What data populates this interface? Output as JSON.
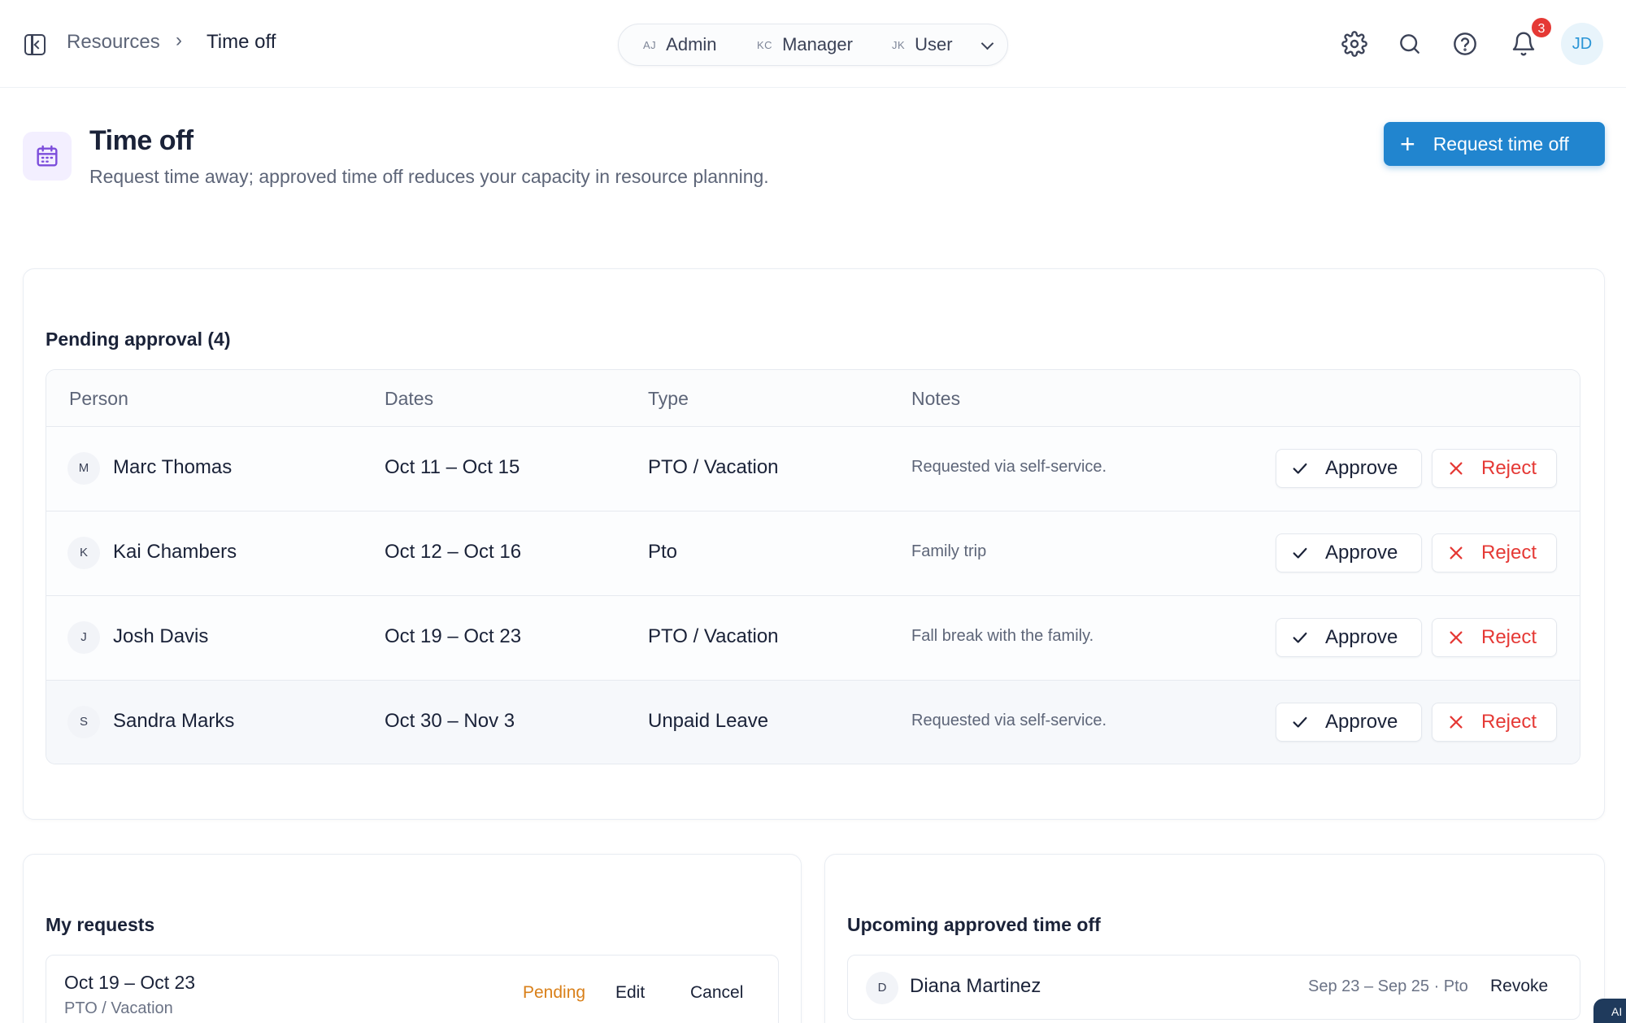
{
  "breadcrumb": {
    "parent": "Resources",
    "separator": "›",
    "current": "Time off"
  },
  "role_switch": {
    "roles": [
      {
        "initials": "AJ",
        "label": "Admin"
      },
      {
        "initials": "KC",
        "label": "Manager"
      },
      {
        "initials": "JK",
        "label": "User"
      }
    ]
  },
  "topbar": {
    "notification_count": "3",
    "avatar_initials": "JD"
  },
  "header": {
    "title": "Time off",
    "subtitle": "Request time away; approved time off reduces your capacity in resource planning.",
    "request_button": "Request time off",
    "request_button_icon": "+"
  },
  "pending": {
    "title": "Pending approval (4)",
    "columns": {
      "person": "Person",
      "dates": "Dates",
      "type": "Type",
      "notes": "Notes"
    },
    "rows": [
      {
        "initial": "M",
        "person": "Marc Thomas",
        "dates": "Oct 11 – Oct 15",
        "type": "PTO / Vacation",
        "notes": "Requested via self-service."
      },
      {
        "initial": "K",
        "person": "Kai Chambers",
        "dates": "Oct 12 – Oct 16",
        "type": "Pto",
        "notes": "Family trip"
      },
      {
        "initial": "J",
        "person": "Josh Davis",
        "dates": "Oct 19 – Oct 23",
        "type": "PTO / Vacation",
        "notes": "Fall break with the family."
      },
      {
        "initial": "S",
        "person": "Sandra Marks",
        "dates": "Oct 30 – Nov 3",
        "type": "Unpaid Leave",
        "notes": "Requested via self-service."
      }
    ],
    "approve_label": "Approve",
    "reject_label": "Reject"
  },
  "my_requests": {
    "title": "My requests",
    "items": [
      {
        "dates": "Oct 19 – Oct 23",
        "type": "PTO / Vacation",
        "status": "Pending",
        "edit": "Edit",
        "cancel": "Cancel"
      }
    ]
  },
  "upcoming": {
    "title": "Upcoming approved time off",
    "items": [
      {
        "initial": "D",
        "name": "Diana Martinez",
        "dates": "Sep 23 – Sep 25 · Pto",
        "action": "Revoke"
      }
    ]
  },
  "ai_chip": {
    "label": "AI"
  },
  "colors": {
    "accent": "#2185cf",
    "reject": "#e53935",
    "pending": "#d9801a",
    "page_icon": "#7c4ddb",
    "text": "#1a2238",
    "muted": "#5d6578"
  }
}
